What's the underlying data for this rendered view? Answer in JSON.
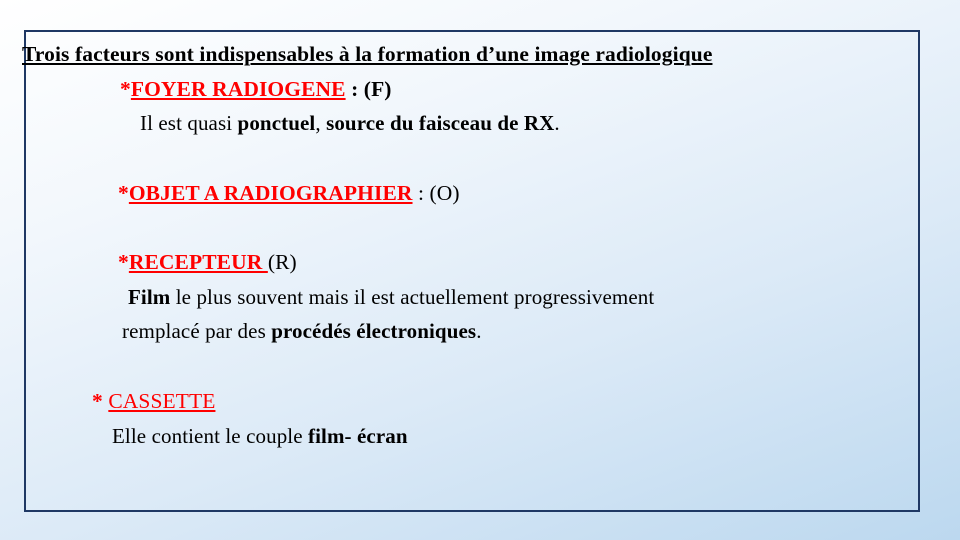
{
  "slide": {
    "title_line": {
      "text": "Trois facteurs sont indispensables à la formation d’une image radiologique"
    },
    "foyer": {
      "star": "*",
      "label": "FOYER RADIOGENE",
      "suffix": " : (F)"
    },
    "foyer_desc": {
      "part1": "Il est quasi ",
      "part2": "ponctuel",
      "part3": ", ",
      "part4": "source du faisceau de RX",
      "part5": "."
    },
    "objet": {
      "star": "*",
      "label": "OBJET A RADIOGRAPHIER",
      "suffix": " : (O)"
    },
    "recepteur": {
      "star": "*",
      "label": "RECEPTEUR ",
      "suffix": " (R)"
    },
    "film_line1": {
      "part1": "Film",
      "part2": " le plus souvent mais il est actuellement progressivement"
    },
    "film_line2": {
      "part1": "remplacé par des ",
      "part2": "procédés électroniques",
      "part3": "."
    },
    "cassette": {
      "star": "* ",
      "label": "CASSETTE"
    },
    "cassette_desc": {
      "part1": "Elle contient le couple ",
      "part2": "film- écran"
    },
    "colors": {
      "accent_red": "#ff0000",
      "border_blue": "#1f3864",
      "text_black": "#000000"
    }
  }
}
